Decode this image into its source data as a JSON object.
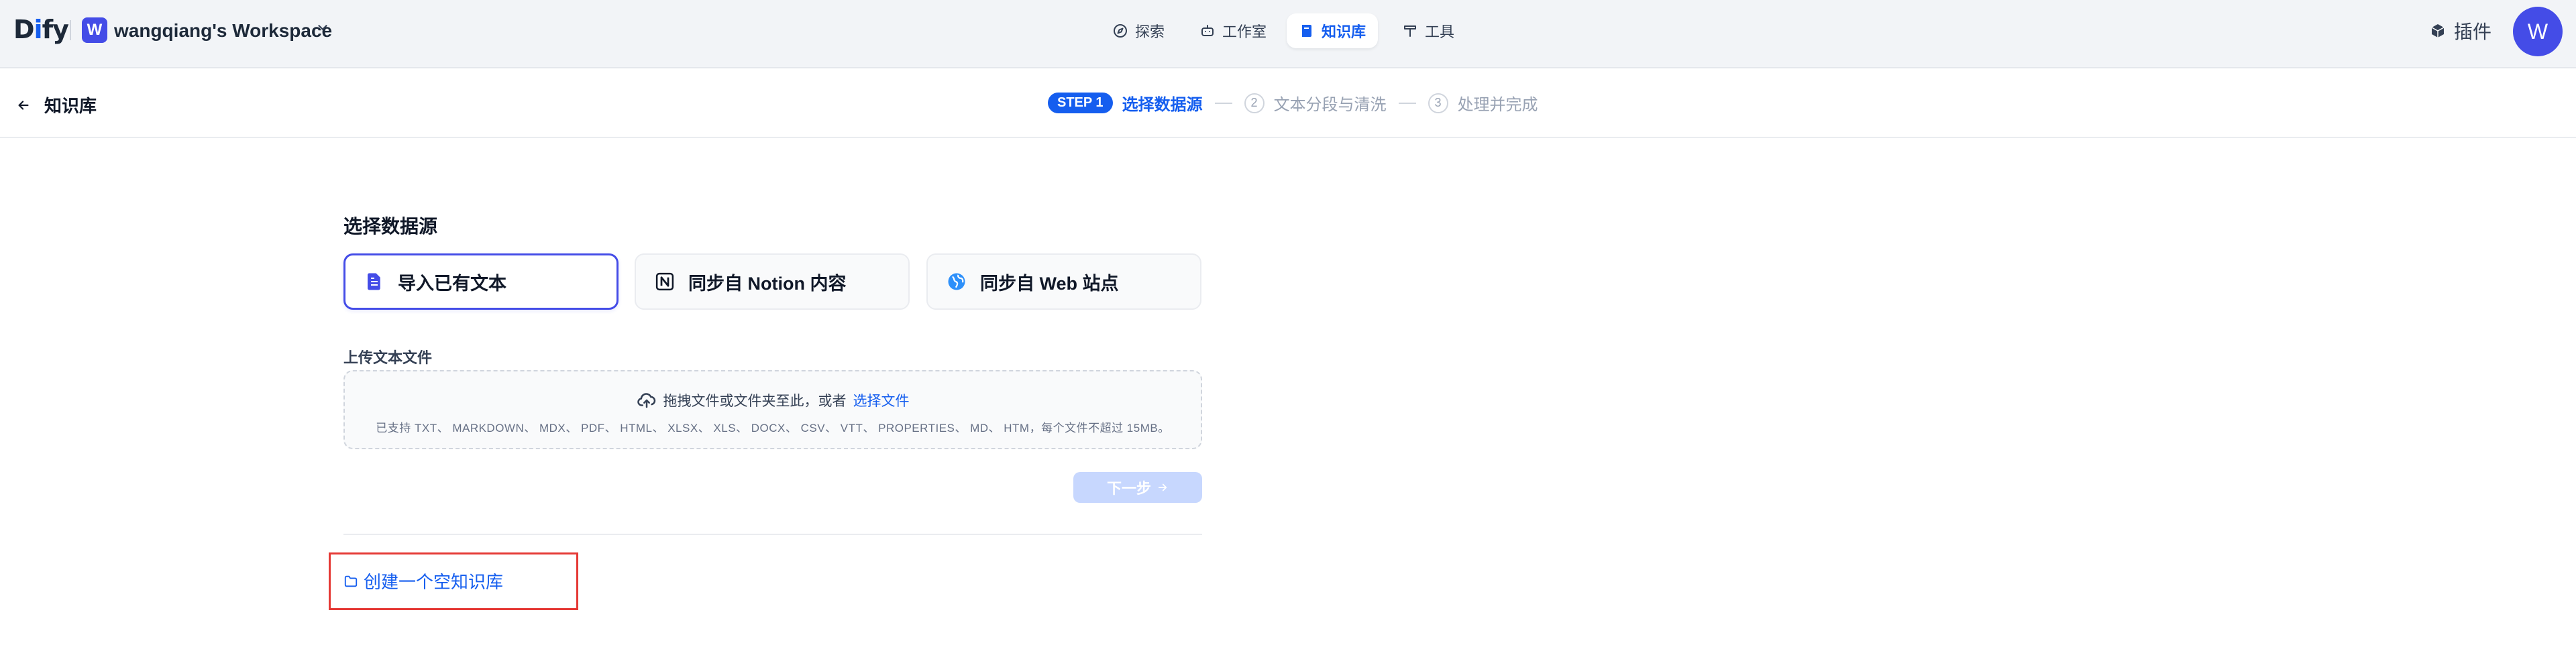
{
  "topbar": {
    "logo": {
      "pre": "D",
      "i": "i",
      "post": "fy"
    },
    "workspace": {
      "avatar": "W",
      "name": "wangqiang's Workspace"
    },
    "nav": [
      {
        "label": "探索",
        "icon": "explore-icon"
      },
      {
        "label": "工作室",
        "icon": "studio-icon"
      },
      {
        "label": "知识库",
        "icon": "knowledge-icon",
        "active": true
      },
      {
        "label": "工具",
        "icon": "tools-icon"
      }
    ],
    "plugins_label": "插件",
    "user_avatar": "W"
  },
  "subheader": {
    "back_label": "知识库",
    "steps": {
      "badge": "STEP 1",
      "step1": "选择数据源",
      "step2_num": "2",
      "step2": "文本分段与清洗",
      "step3_num": "3",
      "step3": "处理并完成"
    }
  },
  "main": {
    "title": "选择数据源",
    "sources": [
      {
        "label": "导入已有文本",
        "icon": "document-icon",
        "selected": true
      },
      {
        "label": "同步自 Notion 内容",
        "icon": "notion-icon",
        "selected": false
      },
      {
        "label": "同步自 Web 站点",
        "icon": "globe-icon",
        "selected": false
      }
    ],
    "upload": {
      "label": "上传文本文件",
      "prompt": "拖拽文件或文件夹至此，或者",
      "link": "选择文件",
      "supported": "已支持 TXT、 MARKDOWN、 MDX、 PDF、 HTML、 XLSX、 XLS、 DOCX、 CSV、 VTT、 PROPERTIES、 MD、 HTM，每个文件不超过 15MB。"
    },
    "next_label": "下一步",
    "create_empty_label": "创建一个空知识库"
  },
  "colors": {
    "accent": "#155eef",
    "avatar": "#444ce7",
    "highlight_box": "#e53935"
  }
}
